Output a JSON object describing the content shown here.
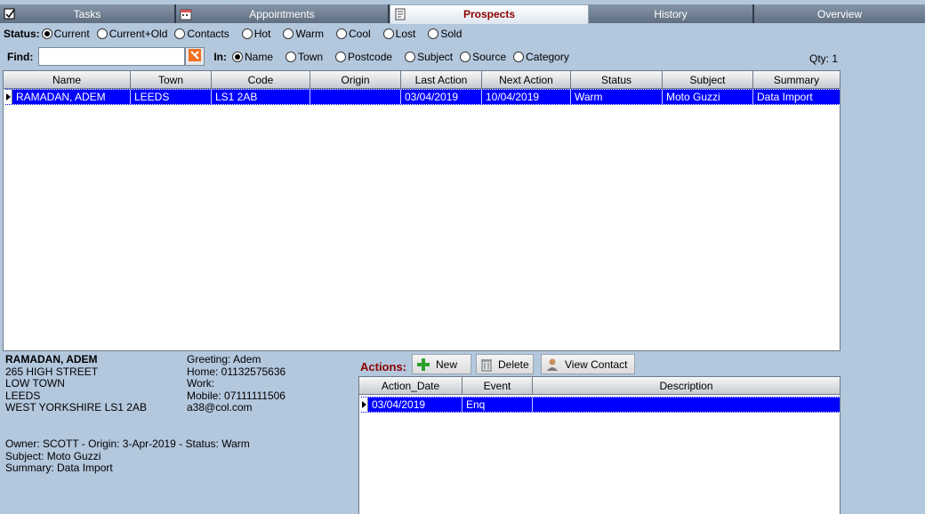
{
  "tabs": [
    {
      "label": "Tasks"
    },
    {
      "label": "Appointments"
    },
    {
      "label": "Prospects"
    },
    {
      "label": "History"
    },
    {
      "label": "Overview"
    }
  ],
  "status": {
    "label": "Status:",
    "options": [
      "Current",
      "Current+Old",
      "Contacts",
      "Hot",
      "Warm",
      "Cool",
      "Lost",
      "Sold"
    ],
    "selected": "Current"
  },
  "find": {
    "label": "Find:",
    "value": "",
    "in_label": "In:",
    "options": [
      "Name",
      "Town",
      "Postcode",
      "Subject",
      "Source",
      "Category"
    ],
    "selected": "Name",
    "qty": "Qty: 1"
  },
  "prospects_grid": {
    "columns": [
      "Name",
      "Town",
      "Code",
      "Origin",
      "Last Action",
      "Next Action",
      "Status",
      "Subject",
      "Summary"
    ],
    "rows": [
      [
        "RAMADAN, ADEM",
        "LEEDS",
        "LS1 2AB",
        "",
        "03/04/2019",
        "10/04/2019",
        "Warm",
        "Moto Guzzi",
        "Data Import"
      ]
    ]
  },
  "details": {
    "name": "RAMADAN, ADEM",
    "address1": "265 HIGH STREET",
    "address2": "LOW TOWN",
    "city": "LEEDS",
    "county_postcode": "WEST YORKSHIRE LS1 2AB",
    "greeting": "Greeting: Adem",
    "home": "Home: 01132575636",
    "work": "Work:",
    "mobile": "Mobile: 07111111506",
    "email": "a38@col.com",
    "owner_line": "Owner: SCOTT - Origin: 3-Apr-2019 - Status: Warm",
    "subject_line": "Subject: Moto Guzzi",
    "summary_line": "Summary: Data Import"
  },
  "actions": {
    "label": "Actions:",
    "new_label": "New",
    "delete_label": "Delete",
    "view_contact_label": "View Contact",
    "columns": [
      "Action_Date",
      "Event",
      "Description"
    ],
    "rows": [
      [
        "03/04/2019",
        "Enq",
        ""
      ]
    ]
  }
}
